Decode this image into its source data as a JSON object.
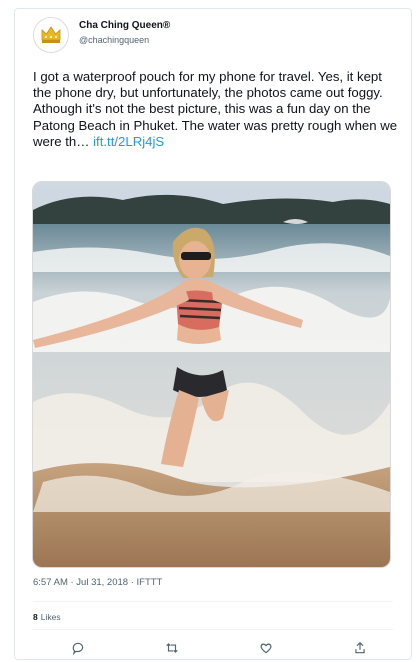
{
  "tweet": {
    "display_name": "Cha Ching Queen®",
    "handle": "@chachingqueen",
    "text_line1": "I got a waterproof pouch for my phone for travel.  Yes, it kept the phone dry, but unfortunately, the photos came out foggy.",
    "text_line2_prefix": "Athough it's not the best picture, this was a fun day on the Patong Beach in Phuket.  The water was pretty rough when we were th… ",
    "link_text": "ift.tt/2LRj4jS",
    "timestamp": "6:57 AM · Jul 31, 2018 · IFTTT",
    "likes_count": "8",
    "likes_label": "Likes"
  },
  "actions": {
    "reply_icon": "reply-icon",
    "retweet_icon": "retweet-icon",
    "like_icon": "like-icon",
    "share_icon": "share-icon"
  },
  "colors": {
    "link": "#1d9bf0",
    "text": "#0f1419",
    "muted": "#536471"
  }
}
